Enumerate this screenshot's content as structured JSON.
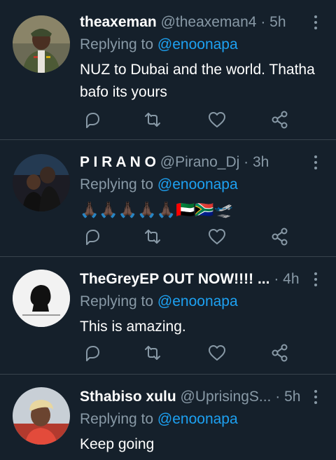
{
  "reply_prefix": "Replying to",
  "tweets": [
    {
      "name": "theaxeman",
      "handle": "@theaxeman4",
      "dot": "·",
      "time": "5h",
      "mention": "@enoonapa",
      "text": "NUZ to Dubai and the world. Thatha bafo its yours"
    },
    {
      "name": "P I R A N O",
      "handle": "@Pirano_Dj",
      "dot": "·",
      "time": "3h",
      "mention": "@enoonapa",
      "text": "🙏🏿🙏🏿🙏🏿🙏🏿🙏🏿🇦🇪🇿🇦🛫"
    },
    {
      "name": "TheGreyEP OUT NOW!!!! ...",
      "handle": "",
      "dot": "·",
      "time": "4h",
      "mention": "@enoonapa",
      "text": "This is amazing."
    },
    {
      "name": "Sthabiso xulu",
      "handle": "@UprisingS...",
      "dot": "·",
      "time": "5h",
      "mention": "@enoonapa",
      "text": "Keep going"
    }
  ],
  "icons": {
    "reply": "reply-icon",
    "retweet": "retweet-icon",
    "like": "like-icon",
    "share": "share-icon",
    "more": "more-vertical-icon"
  },
  "colors": {
    "background": "#15202b",
    "divider": "#38444d",
    "secondary_text": "#8899a6",
    "mention": "#1da1f2"
  }
}
